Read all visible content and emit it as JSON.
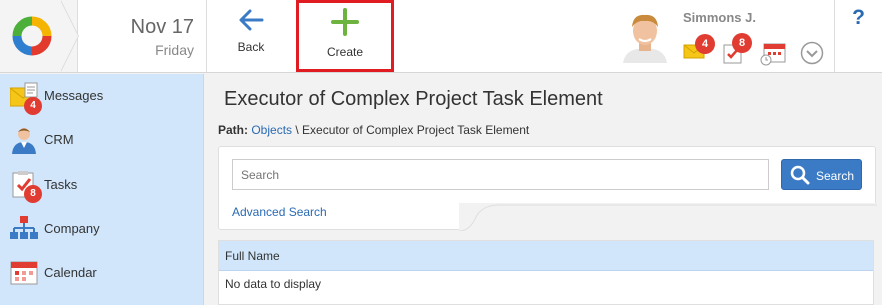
{
  "header": {
    "date_day": "Nov 17",
    "date_weekday": "Friday",
    "back_label": "Back",
    "create_label": "Create",
    "user_name": "Simmons J.",
    "messages_badge": "4",
    "tasks_badge": "8",
    "help_label": "?"
  },
  "sidebar": {
    "items": [
      {
        "label": "Messages",
        "badge": "4",
        "icon": "envelope-icon"
      },
      {
        "label": "CRM",
        "icon": "person-icon"
      },
      {
        "label": "Tasks",
        "badge": "8",
        "icon": "checklist-icon"
      },
      {
        "label": "Company",
        "icon": "org-chart-icon"
      },
      {
        "label": "Calendar",
        "icon": "calendar-icon"
      }
    ]
  },
  "main": {
    "title": "Executor of Complex Project Task Element",
    "path_prefix": "Path:",
    "path_link": "Objects",
    "path_rest": " \\ Executor of Complex Project Task Element",
    "search_placeholder": "Search",
    "search_button": "Search",
    "advanced_search": "Advanced Search",
    "grid": {
      "columns": [
        "Full Name"
      ],
      "empty_text": "No data to display"
    }
  },
  "colors": {
    "accent_blue": "#3b7bc6",
    "sidebar_bg": "#d1e6fb",
    "badge_red": "#e03c31",
    "create_green": "#6cb33f",
    "highlight_red": "#e01b22"
  }
}
